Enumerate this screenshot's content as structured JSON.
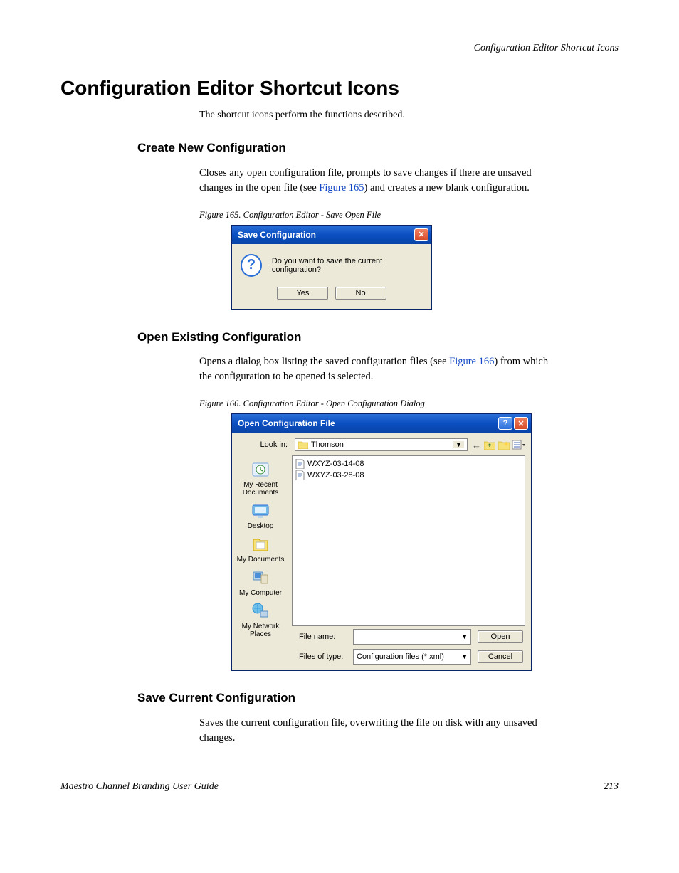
{
  "running_header": "Configuration Editor Shortcut Icons",
  "h1": "Configuration Editor Shortcut Icons",
  "intro": "The shortcut icons perform the functions described.",
  "sections": {
    "create": {
      "heading": "Create New Configuration",
      "text_before_link": "Closes any open configuration file, prompts to save changes if there are unsaved changes in the open file (see ",
      "link": "Figure 165",
      "text_after_link": ") and creates a new blank configuration."
    },
    "open": {
      "heading": "Open Existing Configuration",
      "text_before_link": "Opens a dialog box listing the saved configuration files (see ",
      "link": "Figure 166",
      "text_after_link": ") from which the configuration to be opened is selected."
    },
    "save": {
      "heading": "Save Current Configuration",
      "text": "Saves the current configuration file, overwriting the file on disk with any unsaved changes."
    }
  },
  "figures": {
    "f165": "Figure 165.  Configuration Editor - Save Open File",
    "f166": "Figure 166.  Configuration Editor - Open Configuration Dialog"
  },
  "save_dialog": {
    "title": "Save Configuration",
    "message": "Do you want to save the current configuration?",
    "yes": "Yes",
    "no": "No"
  },
  "open_dialog": {
    "title": "Open Configuration File",
    "look_in_label": "Look in:",
    "look_in_value": "Thomson",
    "places": {
      "recent": "My Recent Documents",
      "desktop": "Desktop",
      "mydocs": "My Documents",
      "mycomp": "My Computer",
      "mynet": "My Network Places"
    },
    "files": [
      "WXYZ-03-14-08",
      "WXYZ-03-28-08"
    ],
    "file_name_label": "File name:",
    "file_name_value": "",
    "file_type_label": "Files of type:",
    "file_type_value": "Configuration files (*.xml)",
    "open_btn": "Open",
    "cancel_btn": "Cancel"
  },
  "footer": {
    "left": "Maestro Channel Branding User Guide",
    "right": "213"
  }
}
